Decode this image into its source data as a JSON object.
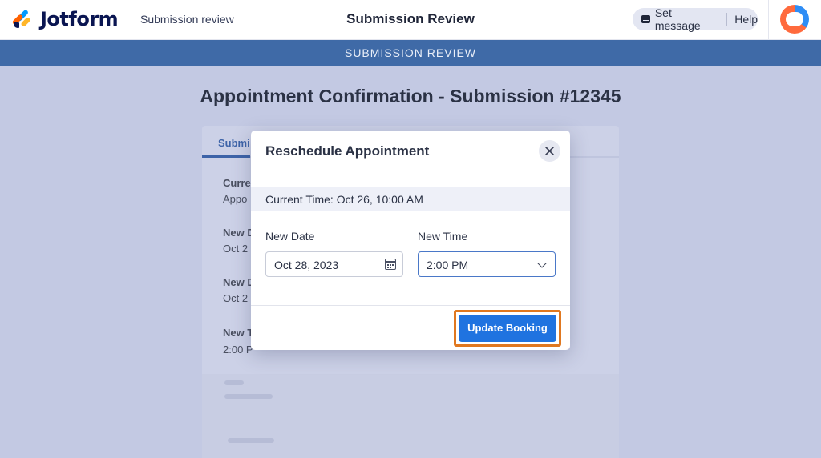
{
  "header": {
    "logo_text": "Jotform",
    "breadcrumb": "Submission review",
    "title": "Submission Review",
    "set_message_label": "Set message",
    "help_label": "Help"
  },
  "band": {
    "label": "SUBMISSION REVIEW"
  },
  "page": {
    "title": "Appointment Confirmation - Submission #12345"
  },
  "background_card": {
    "tab_label": "Submi",
    "rows": [
      {
        "label": "Curre",
        "value": "Appo"
      },
      {
        "label": "New D",
        "value": "Oct 2"
      },
      {
        "label": "New D",
        "value": "Oct 2"
      },
      {
        "label": "New T",
        "value": "2:00 P"
      }
    ]
  },
  "modal": {
    "title": "Reschedule Appointment",
    "current_time": "Current Time: Oct 26, 10:00 AM",
    "new_date_label": "New Date",
    "new_date_value": "Oct 28, 2023",
    "new_time_label": "New Time",
    "new_time_value": "2:00 PM",
    "submit_label": "Update Booking"
  },
  "colors": {
    "brand_navy": "#0a1551",
    "band_blue": "#3f6aa7",
    "primary_button": "#1f73e0",
    "highlight_orange": "#e07820",
    "overlay": "#c3c9e3"
  },
  "icons": [
    "jotform-logo-icon",
    "message-icon",
    "avatar-icon",
    "close-icon",
    "calendar-icon",
    "chevron-down-icon"
  ]
}
